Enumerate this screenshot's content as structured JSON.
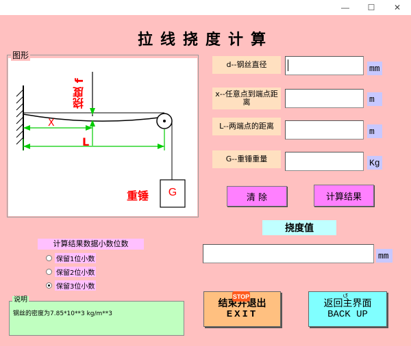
{
  "window": {
    "controls": {
      "minimize": "—",
      "maximize": "☐",
      "close": "✕"
    }
  },
  "title": "拉线挠度计算",
  "figure": {
    "group_label": "图形",
    "label_deflection": "挠度 f",
    "label_x": "X",
    "label_L": "L",
    "label_weight": "重锤",
    "label_G": "G"
  },
  "params": [
    {
      "label": "d--钢丝直径",
      "value": "",
      "unit": "mm"
    },
    {
      "label": "x--任意点到端点距离",
      "value": "",
      "unit": "m"
    },
    {
      "label": "L--两端点的距离",
      "value": "",
      "unit": "m"
    },
    {
      "label": "G--重锤重量",
      "value": "",
      "unit": "Kg"
    }
  ],
  "buttons": {
    "clear": "清 除",
    "calc": "计算结果",
    "exit_line1": "结束并退出",
    "exit_line2": "EXIT",
    "exit_stop_badge": "STOP",
    "back_line1": "返回主界面",
    "back_line2": "BACK UP"
  },
  "result": {
    "label": "挠度值",
    "value": "",
    "unit": "mm"
  },
  "decimals": {
    "caption": "计算结果数据小数位数",
    "options": [
      "保留1位小数",
      "保留2位小数",
      "保留3位小数"
    ],
    "selected": "保留3位小数"
  },
  "note": {
    "label": "说明",
    "text": "钢丝的密度为7.85*10**3  kg/m**3"
  },
  "colors": {
    "background": "#ffc0c0",
    "param_label": "#ffe0c0",
    "unit": "#c8c8ff",
    "action_button": "#ff80ff",
    "result_label": "#c0ffff",
    "exit_button": "#ffc080",
    "back_button": "#80ffff",
    "note_box": "#c0ffc0",
    "figure_red": "#ff0000",
    "figure_green": "#00cc00"
  }
}
